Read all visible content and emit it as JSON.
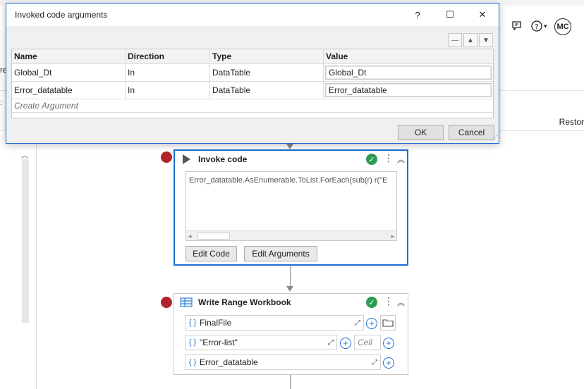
{
  "app": {
    "left_edge_1": "re",
    "left_edge_2": ":",
    "restore_label": "Restor",
    "avatar_initials": "MC",
    "icons": [
      "feedback-icon",
      "help-icon",
      "chevron-down-icon"
    ]
  },
  "dialog": {
    "title": "Invoked code arguments",
    "controls": {
      "help": "?",
      "maximize": "☐",
      "close": "✕"
    },
    "grid_tools": {
      "remove": "—",
      "up": "▲",
      "down": "▼"
    },
    "columns": [
      "Name",
      "Direction",
      "Type",
      "Value"
    ],
    "rows": [
      {
        "name": "Global_Dt",
        "direction": "In",
        "type": "DataTable",
        "value": "Global_Dt"
      },
      {
        "name": "Error_datatable",
        "direction": "In",
        "type": "DataTable",
        "value": "Error_datatable"
      }
    ],
    "create_argument": "Create Argument",
    "ok_label": "OK",
    "cancel_label": "Cancel"
  },
  "invoke_code": {
    "title": "Invoke code",
    "code": "Error_datatable.AsEnumerable.ToList.ForEach(sub(r) r(\"E",
    "edit_code_label": "Edit Code",
    "edit_arguments_label": "Edit Arguments"
  },
  "write_range": {
    "title": "Write Range Workbook",
    "file_field": "FinalFile",
    "sheet_field": "\"Error-list\"",
    "cell_placeholder": "Cell",
    "datatable_field": "Error_datatable",
    "brace_label": "{ }"
  },
  "colors": {
    "accent": "#1a6fd1",
    "breakpoint": "#b4232a",
    "valid": "#2e9b52"
  }
}
